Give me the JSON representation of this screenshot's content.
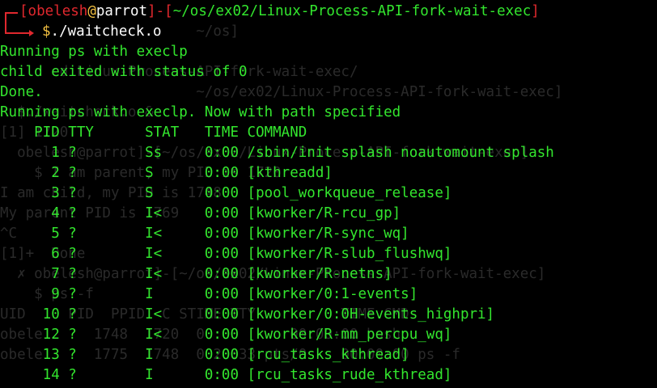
{
  "ghost_text": [
    "",
    "                       ~/os]",
    "",
    "      cd Linux-Process-API-fork-wait-exec/",
    "                       ~/os/ex02/Linux-Process-API-fork-wait-exec]",
    "  $./waitcheck.o &",
    "[1] 1720",
    "  obelesh@parrot]-[~/os/ex02/Linux-Process-API-fork-wait-exec]",
    "    $ I am parent, my PID is 1720",
    "I am child, my PID is 1748",
    "My parent PID is 1769",
    "^C",
    "[1]+  Done                ",
    "  ✗ obelesh@parrot]-[~/os/ex02/Linux-Process-API-fork-wait-exec]",
    "    $ ps -f",
    "UID     PID  PPID  C STIME TTY          TIME CMD",
    "obele      1748  1720  0          00:00:00 bash",
    "obele      1775  1748  0 20:33 pts/0    00:00:00 ps -f"
  ],
  "prompt": {
    "open_bracket": "[",
    "user": "obelesh",
    "at": "@",
    "host": "parrot",
    "close_bracket": "]",
    "dash": "-",
    "path_open": "[",
    "path": "~/os/ex02/Linux-Process-API-fork-wait-exec",
    "path_close": "]",
    "dollar": "$",
    "command": "./waitcheck.o"
  },
  "output": [
    "Running ps with execlp",
    "child exited with status of 0",
    "Done.",
    "Running ps with execlp. Now with path specified",
    "    PID TTY      STAT   TIME COMMAND",
    "      1 ?        Ss     0:00 /sbin/init splash noautomount splash",
    "      2 ?        S      0:00 [kthreadd]",
    "      3 ?        S      0:00 [pool_workqueue_release]",
    "      4 ?        I<     0:00 [kworker/R-rcu_gp]",
    "      5 ?        I<     0:00 [kworker/R-sync_wq]",
    "      6 ?        I<     0:00 [kworker/R-slub_flushwq]",
    "      7 ?        I<     0:00 [kworker/R-netns]",
    "      9 ?        I      0:00 [kworker/0:1-events]",
    "     10 ?        I<     0:00 [kworker/0:0H-events_highpri]",
    "     12 ?        I<     0:00 [kworker/R-mm_percpu_wq]",
    "     13 ?        I      0:00 [rcu_tasks_kthread]",
    "     14 ?        I      0:00 [rcu_tasks_rude_kthread]"
  ],
  "colors": {
    "background": "#000000",
    "text_green": "#33e62e",
    "prompt_red": "#e0282e",
    "user_white": "#ffffff",
    "dollar_yellow": "#f5c242"
  }
}
